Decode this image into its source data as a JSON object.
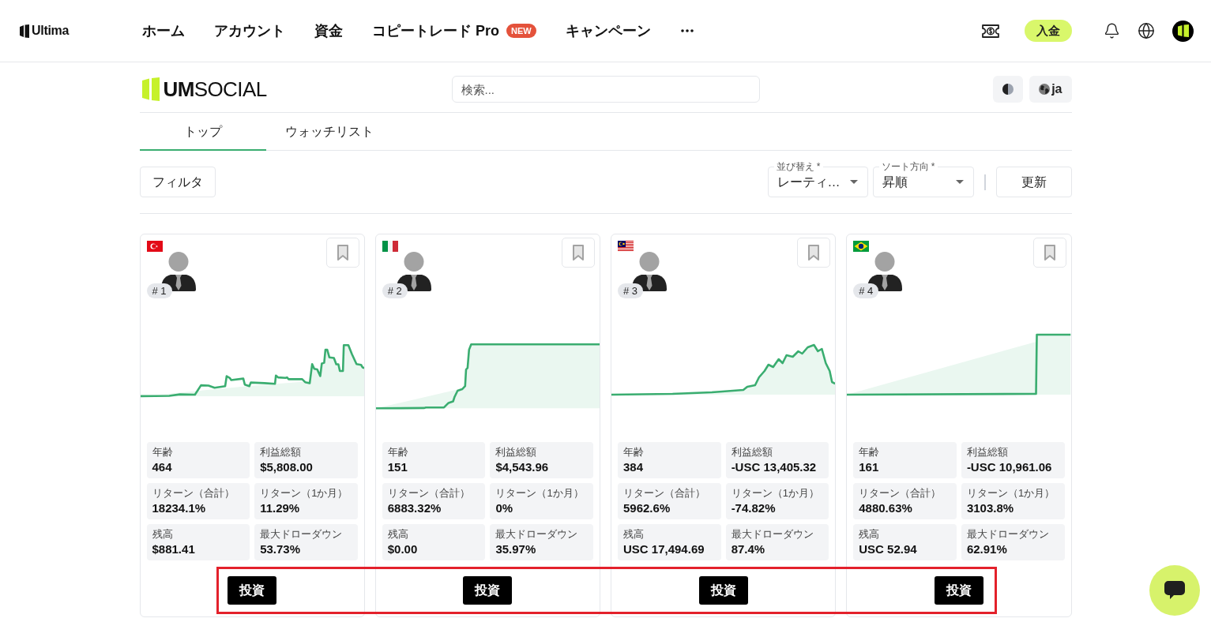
{
  "top_nav": {
    "brand": "Ultima",
    "items": [
      {
        "label": "ホーム"
      },
      {
        "label": "アカウント"
      },
      {
        "label": "資金"
      },
      {
        "label": "コピートレード Pro",
        "badge": "NEW"
      },
      {
        "label": "キャンペーン"
      }
    ],
    "deposit_button": "入金"
  },
  "header": {
    "logo": "**UM**SOCIAL",
    "search": {
      "placeholder": "検索..."
    },
    "language_button": "ja"
  },
  "tabs": [
    {
      "label": "トップ",
      "selected": true
    },
    {
      "label": "ウォッチリスト",
      "selected": false
    }
  ],
  "toolbar": {
    "filter_button": "フィルタ",
    "selects": [
      {
        "label": "並び替え *",
        "value": "レーティ…"
      },
      {
        "label": "ソート方向 *",
        "value": "昇順"
      }
    ],
    "refresh_button": "更新"
  },
  "cards": [
    {
      "rank": "# 1",
      "bookmarked": false,
      "stats": [
        {
          "label": "年齢",
          "value": "464"
        },
        {
          "label": "利益総額",
          "value": "$5,808.00"
        },
        {
          "label": "リターン（合計）",
          "value": "18234.1%"
        },
        {
          "label": "リターン（1か月）",
          "value": "11.29%"
        },
        {
          "label": "残高",
          "value": "$881.41"
        },
        {
          "label": "最大ドローダウン",
          "value": "53.73%"
        }
      ],
      "invest_button": "投資"
    },
    {
      "rank": "# 2",
      "bookmarked": false,
      "stats": [
        {
          "label": "年齢",
          "value": "151"
        },
        {
          "label": "利益総額",
          "value": "$4,543.96"
        },
        {
          "label": "リターン（合計）",
          "value": "6883.32%"
        },
        {
          "label": "リターン（1か月）",
          "value": "0%"
        },
        {
          "label": "残高",
          "value": "$0.00"
        },
        {
          "label": "最大ドローダウン",
          "value": "35.97%"
        }
      ],
      "invest_button": "投資"
    },
    {
      "rank": "# 3",
      "bookmarked": false,
      "stats": [
        {
          "label": "年齢",
          "value": "384"
        },
        {
          "label": "利益総額",
          "value": "-USC 13,405.32"
        },
        {
          "label": "リターン（合計）",
          "value": "5962.6%"
        },
        {
          "label": "リターン（1か月）",
          "value": "-74.82%"
        },
        {
          "label": "残高",
          "value": "USC 17,494.69"
        },
        {
          "label": "最大ドローダウン",
          "value": "87.4%"
        }
      ],
      "invest_button": "投資"
    },
    {
      "rank": "# 4",
      "bookmarked": false,
      "stats": [
        {
          "label": "年齢",
          "value": "161"
        },
        {
          "label": "利益総額",
          "value": "-USC 10,961.06"
        },
        {
          "label": "リターン（合計）",
          "value": "4880.63%"
        },
        {
          "label": "リターン（1か月）",
          "value": "3103.8%"
        },
        {
          "label": "残高",
          "value": "USC 52.94"
        },
        {
          "label": "最大ドローダウン",
          "value": "62.91%"
        }
      ],
      "invest_button": "投資"
    }
  ]
}
